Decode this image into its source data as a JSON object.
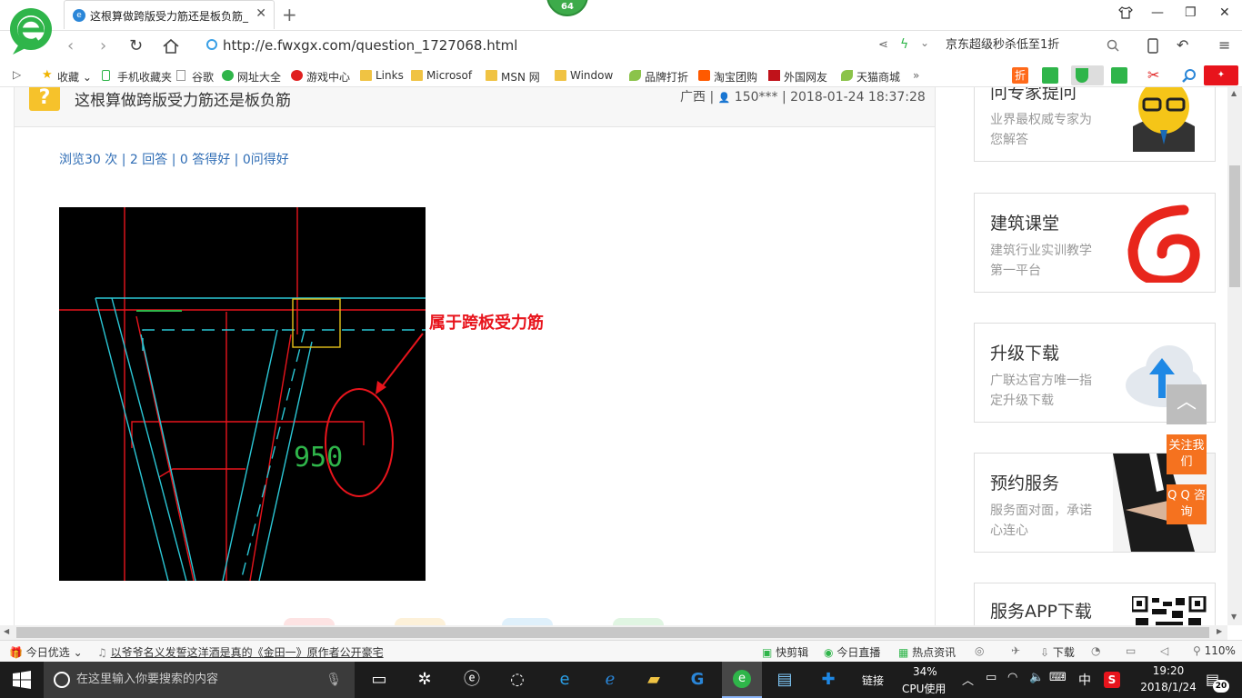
{
  "browser": {
    "tab_title": "这根算做跨版受力筋还是板负筋_",
    "badge_count": "64",
    "url": "http://e.fwxgx.com/question_1727068.html",
    "search_text": "京东超级秒杀低至1折"
  },
  "bookmarks": [
    "收藏",
    "手机收藏夹",
    "谷歌",
    "网址大全",
    "游戏中心",
    "Links",
    "Microsof",
    "MSN 网",
    "Window",
    "品牌打折",
    "淘宝团购",
    "外国网友",
    "天猫商城"
  ],
  "question": {
    "title": "这根算做跨版受力筋还是板负筋",
    "meta_region": "广西 |",
    "meta_user": "150*** | 2018-01-24 18:37:28",
    "stats": "浏览30 次 | 2 回答 | 0 答得好 | 0问得好",
    "cad_label": "950",
    "annotation": "属于跨板受力筋"
  },
  "sidebar": {
    "cards": [
      {
        "title": "问专家提问",
        "sub": "业界最权威专家为您解答"
      },
      {
        "title": "建筑课堂",
        "sub": "建筑行业实训教学第一平台"
      },
      {
        "title": "升级下载",
        "sub": "广联达官方唯一指定升级下载"
      },
      {
        "title": "预约服务",
        "sub": "服务面对面，承诺心连心"
      },
      {
        "title": "服务APP下载",
        "sub": ""
      }
    ],
    "follow": "关注我们",
    "qq": "Q Q 咨询"
  },
  "statusbar": {
    "today": "今日优选",
    "news": "以爷爷名义发誓这洋酒是真的《金田一》原作者公开豪宅",
    "kuaijian": "快剪辑",
    "live": "今日直播",
    "hot": "热点资讯",
    "download": "下载",
    "zoom": "110%"
  },
  "taskbar": {
    "search_placeholder": "在这里输入你要搜索的内容",
    "link_label": "链接",
    "cpu_percent": "34%",
    "cpu_label": "CPU使用",
    "ime": "中",
    "time": "19:20",
    "date": "2018/1/24",
    "notify_count": "20"
  },
  "colors": {
    "accent_link": "#2f6db5",
    "annotation_red": "#e8141c",
    "question_icon": "#f6c22b",
    "orange_button": "#f5721f"
  }
}
